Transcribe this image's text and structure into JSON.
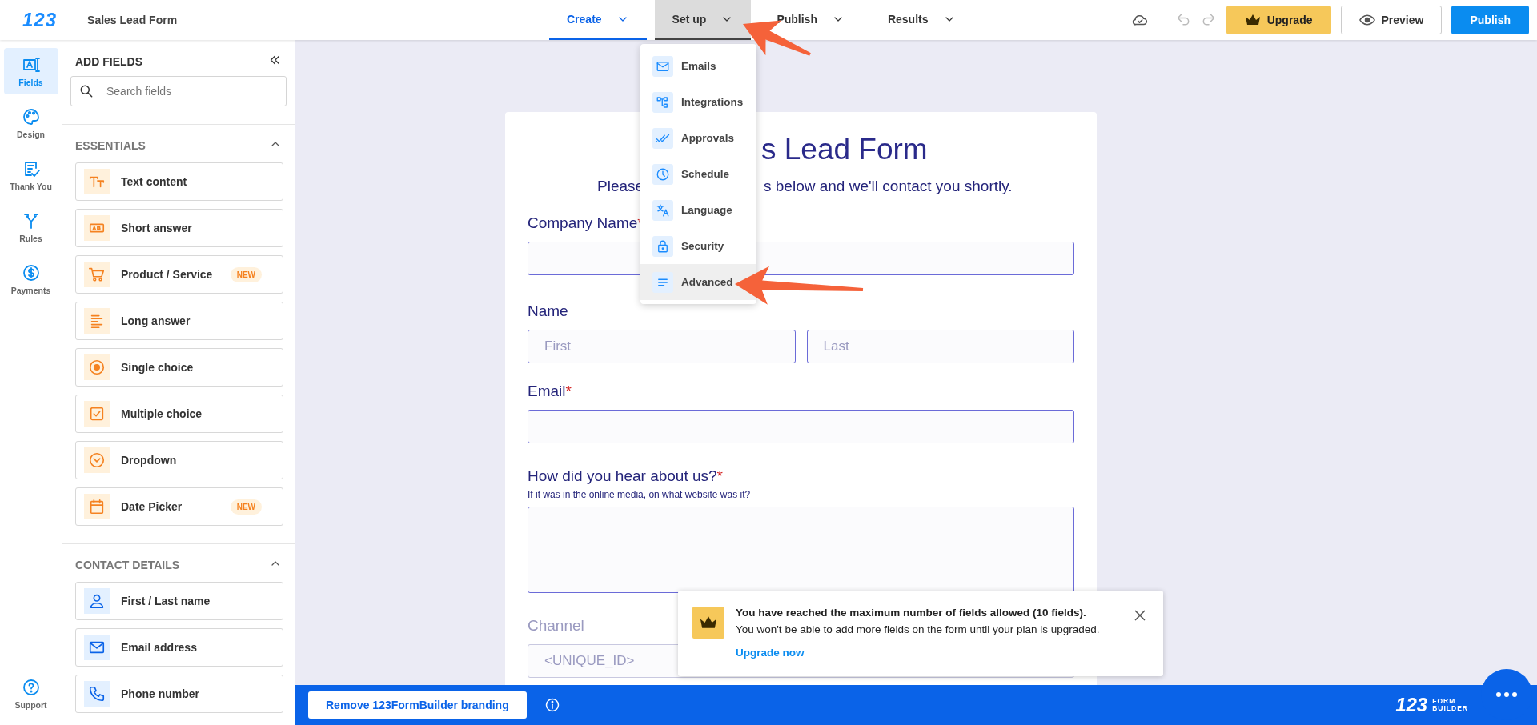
{
  "header": {
    "logo": "123",
    "form_name": "Sales Lead Form",
    "tabs": [
      {
        "label": "Create",
        "selected": true,
        "expanded": false
      },
      {
        "label": "Set up",
        "selected": false,
        "expanded": true
      },
      {
        "label": "Publish",
        "selected": false,
        "expanded": false
      },
      {
        "label": "Results",
        "selected": false,
        "expanded": false
      }
    ],
    "buttons": [
      {
        "label": "Upgrade",
        "kind": "upgrade"
      },
      {
        "label": "Preview",
        "kind": "preview"
      },
      {
        "label": "Publish",
        "kind": "primary"
      }
    ]
  },
  "nav_rail": {
    "items": [
      {
        "label": "Fields",
        "selected": true
      },
      {
        "label": "Design",
        "selected": false
      },
      {
        "label": "Thank You",
        "selected": false
      },
      {
        "label": "Rules",
        "selected": false
      },
      {
        "label": "Payments",
        "selected": false
      }
    ],
    "footer": {
      "label": "Support"
    }
  },
  "fields_panel": {
    "title": "ADD FIELDS",
    "search": {
      "placeholder": "Search fields"
    },
    "sections": [
      {
        "title": "ESSENTIALS",
        "expanded": true,
        "items": [
          {
            "label": "Text content"
          },
          {
            "label": "Short answer"
          },
          {
            "label": "Product / Service",
            "badge": "NEW"
          },
          {
            "label": "Long answer"
          },
          {
            "label": "Single choice"
          },
          {
            "label": "Multiple choice"
          },
          {
            "label": "Dropdown"
          },
          {
            "label": "Date Picker",
            "badge": "NEW"
          }
        ]
      },
      {
        "title": "CONTACT DETAILS",
        "expanded": true,
        "items": [
          {
            "label": "First / Last name"
          },
          {
            "label": "Email address"
          },
          {
            "label": "Phone number"
          }
        ]
      }
    ]
  },
  "setup_menu": {
    "items": [
      {
        "label": "Emails",
        "selected": false
      },
      {
        "label": "Integrations",
        "selected": false
      },
      {
        "label": "Approvals",
        "selected": false
      },
      {
        "label": "Schedule",
        "selected": false
      },
      {
        "label": "Language",
        "selected": false
      },
      {
        "label": "Security",
        "selected": false
      },
      {
        "label": "Advanced",
        "selected": true
      }
    ]
  },
  "form": {
    "title": "s Lead Form",
    "subtitle": [
      "Please",
      "s below and we'll contact you shortly."
    ],
    "fields": [
      {
        "kind": "text",
        "label": "Company Name",
        "mark": "*"
      },
      {
        "kind": "name",
        "label": "Name",
        "placeholders": [
          "First",
          "Last"
        ]
      },
      {
        "kind": "text",
        "label": "Email",
        "mark": "*"
      },
      {
        "kind": "textarea",
        "label": "How did you hear about us?",
        "mark": "*",
        "hint": "If it was in the online media, on what website was it?"
      },
      {
        "kind": "hidden",
        "label": "Channel",
        "value": "<UNIQUE_ID>"
      }
    ]
  },
  "notice": {
    "title": "You have reached the maximum number of fields allowed (10 fields).",
    "message": "You won't be able to add more fields on the form until your plan is upgraded.",
    "link": "Upgrade now"
  },
  "footer_bar": {
    "button": "Remove 123FormBuilder branding",
    "logo": [
      "123",
      "FORM",
      "BUILDER"
    ]
  }
}
